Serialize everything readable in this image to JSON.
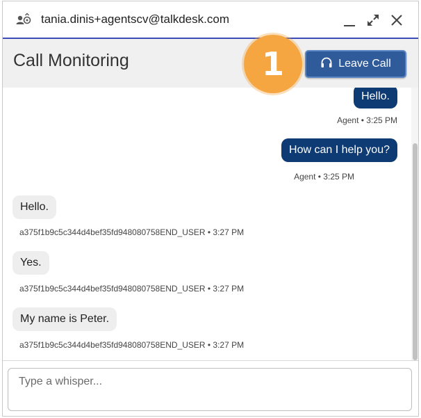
{
  "window": {
    "title": "tania.dinis+agentscv@talkdesk.com"
  },
  "header": {
    "title": "Call Monitoring",
    "leave_label": "Leave Call",
    "step_number": "1"
  },
  "messages": [
    {
      "role": "agent",
      "text": "Hello.",
      "meta": "Agent • 3:25 PM"
    },
    {
      "role": "agent",
      "text": "How can I help you?",
      "meta": "Agent • 3:25 PM"
    },
    {
      "role": "user",
      "text": "Hello.",
      "meta": "a375f1b9c5c344d4bef35fd948080758END_USER • 3:27 PM"
    },
    {
      "role": "user",
      "text": "Yes.",
      "meta": "a375f1b9c5c344d4bef35fd948080758END_USER • 3:27 PM"
    },
    {
      "role": "user",
      "text": "My name is Peter.",
      "meta": "a375f1b9c5c344d4bef35fd948080758END_USER • 3:27 PM"
    }
  ],
  "composer": {
    "placeholder": "Type a whisper..."
  },
  "colors": {
    "accent_line": "#3b4bb8",
    "agent_bubble": "#0e3b73",
    "leave_button": "#2f5b9a",
    "step_badge": "#f5a641"
  }
}
